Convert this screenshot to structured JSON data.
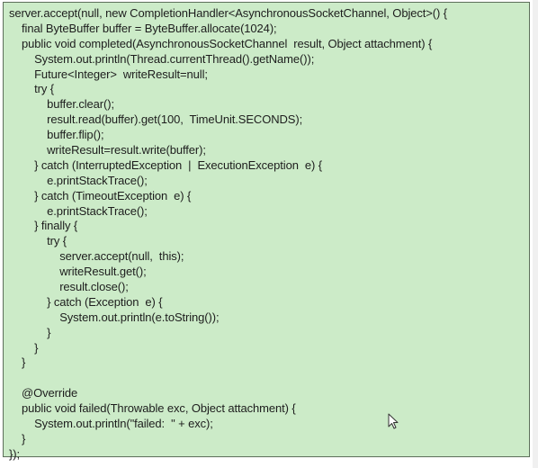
{
  "code": {
    "lines": [
      "server.accept(null, new CompletionHandler<AsynchronousSocketChannel, Object>() {",
      "    final ByteBuffer buffer = ByteBuffer.allocate(1024);",
      "    public void completed(AsynchronousSocketChannel  result, Object attachment) {",
      "        System.out.println(Thread.currentThread().getName());",
      "        Future<Integer>  writeResult=null;",
      "        try {",
      "            buffer.clear();",
      "            result.read(buffer).get(100,  TimeUnit.SECONDS);",
      "            buffer.flip();",
      "            writeResult=result.write(buffer);",
      "        } catch (InterruptedException  |  ExecutionException  e) {",
      "            e.printStackTrace();",
      "        } catch (TimeoutException  e) {",
      "            e.printStackTrace();",
      "        } finally {",
      "            try {",
      "                server.accept(null,  this);",
      "                writeResult.get();",
      "                result.close();",
      "            } catch (Exception  e) {",
      "                System.out.println(e.toString());",
      "            }",
      "        }",
      "    }",
      "",
      "    @Override",
      "    public void failed(Throwable exc, Object attachment) {",
      "        System.out.println(\"failed:  \" + exc);",
      "    }",
      "});"
    ]
  },
  "cursor_icon": "mouse-pointer-icon",
  "colors": {
    "box_background": "#ccebc8",
    "box_border": "#5d6f5a",
    "text": "#1d1d1d"
  }
}
